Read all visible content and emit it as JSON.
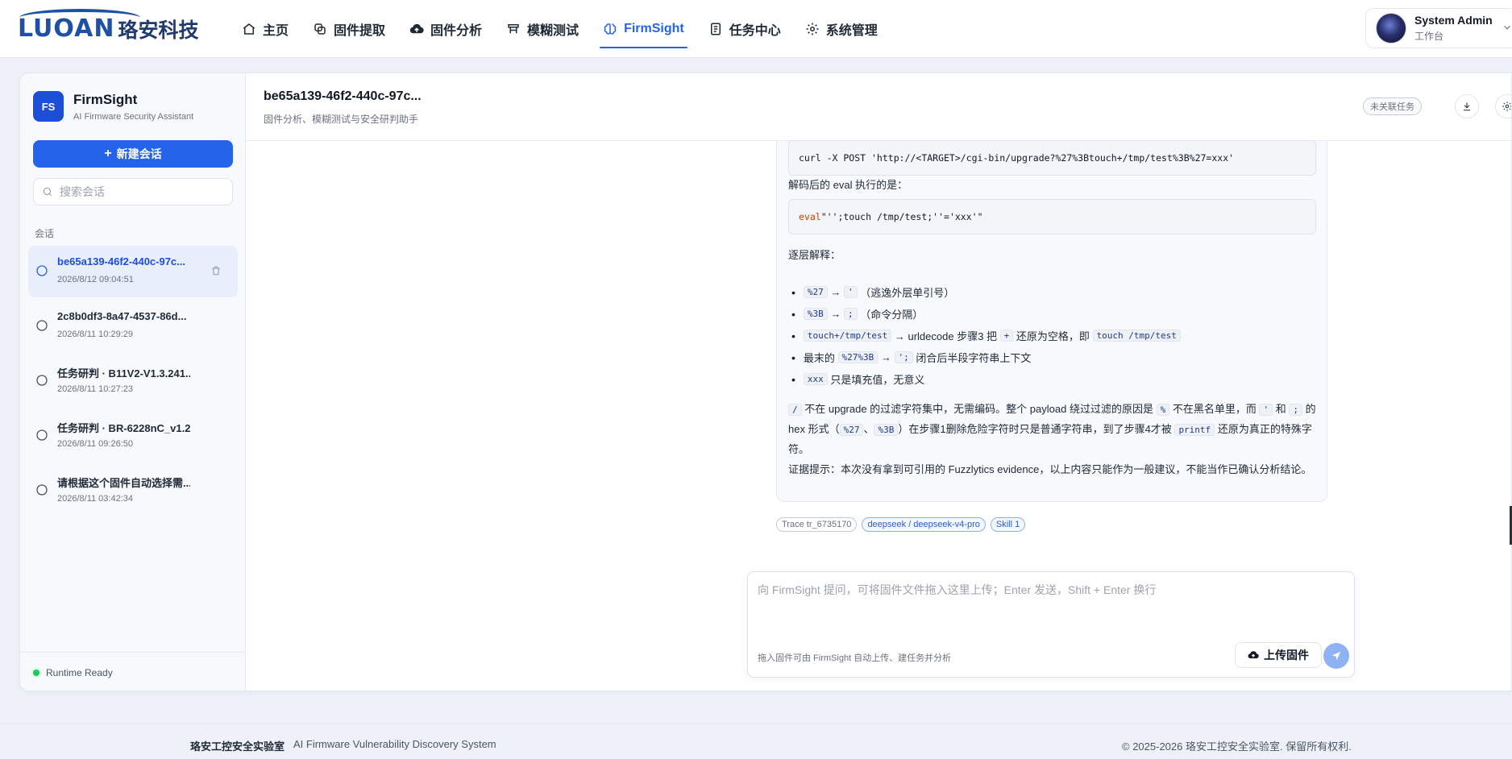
{
  "brand": {
    "logo_text": "LUOAN",
    "logo_cn": "珞安科技"
  },
  "nav": {
    "items": [
      {
        "label": "主页",
        "icon": "home-icon"
      },
      {
        "label": "固件提取",
        "icon": "extract-icon"
      },
      {
        "label": "固件分析",
        "icon": "cloud-icon"
      },
      {
        "label": "模糊测试",
        "icon": "fuzz-icon"
      },
      {
        "label": "FirmSight",
        "icon": "brain-icon",
        "active": true
      },
      {
        "label": "任务中心",
        "icon": "document-icon"
      },
      {
        "label": "系统管理",
        "icon": "gear-icon"
      }
    ],
    "active_color": "#2563eb"
  },
  "user": {
    "name": "System Admin",
    "role": "工作台"
  },
  "sidebar": {
    "badge": "FS",
    "app_name": "FirmSight",
    "app_subtitle": "AI Firmware Security Assistant",
    "new_chat_label": "新建会话",
    "search_placeholder": "搜索会话",
    "section_label": "会话",
    "conversations": [
      {
        "title": "be65a139-46f2-440c-97c...",
        "time": "2026/8/12 09:04:51",
        "active": true
      },
      {
        "title": "2c8b0df3-8a47-4537-86d...",
        "time": "2026/8/11 10:29:29"
      },
      {
        "title": "任务研判 · B11V2-V1.3.241...",
        "time": "2026/8/11 10:27:23"
      },
      {
        "title": "任务研判 · BR-6228nC_v1.2...",
        "time": "2026/8/11 09:26:50"
      },
      {
        "title": "请根据这个固件自动选择需...",
        "time": "2026/8/11 03:42:34"
      }
    ],
    "runtime_status": "Runtime Ready"
  },
  "chat": {
    "title": "be65a139-46f2-440c-97c...",
    "subtitle": "固件分析、模糊测试与安全研判助手",
    "unlinked_label": "未关联任务",
    "message": {
      "curl_cmd": "curl -X POST 'http://<TARGET>/cgi-bin/upgrade?%27%3Btouch+/tmp/test%3B%27=xxx'",
      "eval_intro": "解码后的 eval 执行的是：",
      "eval_kw": "eval",
      "eval_rest": " \"'';touch /tmp/test;''='xxx'\"",
      "step_intro": "逐层解释：",
      "bullets": {
        "b1_code": "%27",
        "b1_arrow": "→",
        "b1_code2": "'",
        "b1_text": "（逃逸外层单引号）",
        "b2_code": "%3B",
        "b2_arrow": "→",
        "b2_code2": ";",
        "b2_text": "（命令分隔）",
        "b3_code": "touch+/tmp/test",
        "b3_text1": "→ urldecode 步骤3 把",
        "b3_code2": "+",
        "b3_text2": "还原为空格，即",
        "b3_code3": "touch /tmp/test",
        "b4_text1": "最末的",
        "b4_code": "%27%3B",
        "b4_arrow": "→",
        "b4_code2": "';",
        "b4_text2": "闭合后半段字符串上下文",
        "b5_code": "xxx",
        "b5_text": "只是填充值，无意义"
      },
      "para1": {
        "code_slash": "/",
        "t1": "不在 upgrade 的过滤字符集中，无需编码。整个 payload 绕过过滤的原因是",
        "code_pct": "%",
        "t2": "不在黑名单里，而",
        "code_quote": "'",
        "t3": "和",
        "code_semi": ";",
        "t4": "的 hex 形式（",
        "code_27": "%27",
        "t5": "、",
        "code_3b": "%3B",
        "t6": "）在步骤1删除危险字符时只是普通字符串，到了步骤4才被",
        "code_printf": "printf",
        "t7": "还原为真正的特殊字符。"
      },
      "evidence": "证据提示：本次没有拿到可引用的 Fuzzlytics evidence，以上内容只能作为一般建议，不能当作已确认分析结论。"
    },
    "tags": {
      "trace": "Trace tr_6735170",
      "model": "deepseek / deepseek-v4-pro",
      "skill": "Skill 1"
    },
    "composer": {
      "placeholder": "向 FirmSight 提问，可将固件文件拖入这里上传；Enter 发送，Shift + Enter 换行",
      "hint": "拖入固件可由 FirmSight 自动上传、建任务并分析",
      "upload_label": "上传固件"
    }
  },
  "footer": {
    "org": "珞安工控安全实验室",
    "system": "AI Firmware Vulnerability Discovery System",
    "copyright": "© 2025-2026 珞安工控安全实验室. 保留所有权利."
  }
}
